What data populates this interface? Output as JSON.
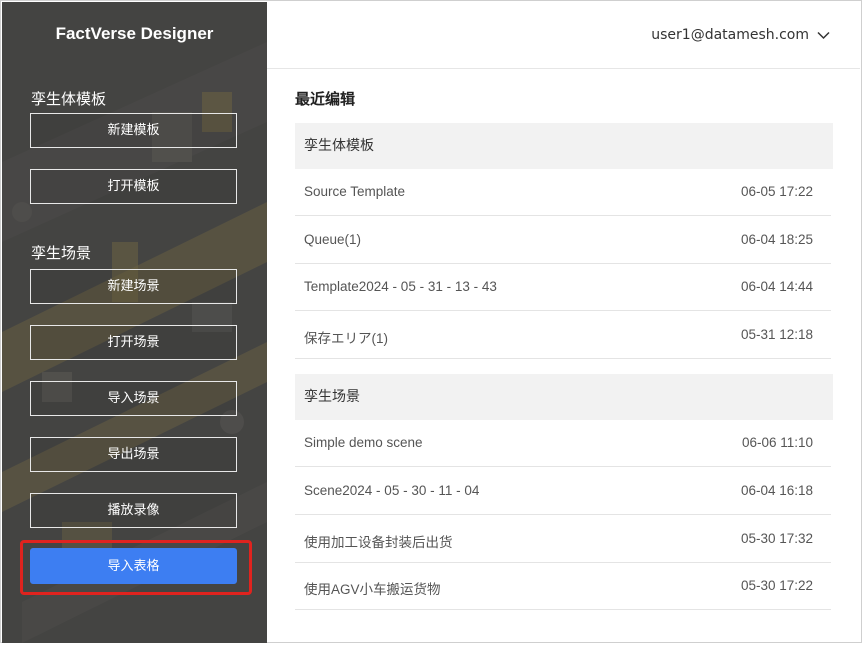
{
  "app": {
    "title": "FactVerse Designer"
  },
  "sidebar": {
    "template_section": {
      "label": "孪生体模板",
      "buttons": [
        "新建模板",
        "打开模板"
      ]
    },
    "scene_section": {
      "label": "孪生场景",
      "buttons": [
        "新建场景",
        "打开场景",
        "导入场景",
        "导出场景",
        "播放录像"
      ]
    },
    "import_table_button": "导入表格"
  },
  "header": {
    "user": "user1@datamesh.com"
  },
  "recent": {
    "title": "最近编辑",
    "groups": [
      {
        "label": "孪生体模板",
        "items": [
          {
            "name": "Source Template",
            "time": "06-05 17:22"
          },
          {
            "name": "Queue(1)",
            "time": "06-04 18:25"
          },
          {
            "name": "Template2024 - 05 - 31 - 13 - 43",
            "time": "06-04 14:44"
          },
          {
            "name": "保存エリア(1)",
            "time": "05-31 12:18"
          }
        ]
      },
      {
        "label": "孪生场景",
        "items": [
          {
            "name": "Simple demo scene",
            "time": "06-06 11:10"
          },
          {
            "name": "Scene2024 - 05 - 30 - 11 - 04",
            "time": "06-04 16:18"
          },
          {
            "name": "使用加工设备封装后出货",
            "time": "05-30 17:32"
          },
          {
            "name": "使用AGV小车搬运货物",
            "time": "05-30 17:22"
          }
        ]
      }
    ]
  },
  "colors": {
    "primary": "#3d7ef2",
    "highlight": "#e0231e",
    "sidebar_bg": "#4a4a4a"
  },
  "icons": {
    "user_menu": "chevron-down-icon"
  }
}
